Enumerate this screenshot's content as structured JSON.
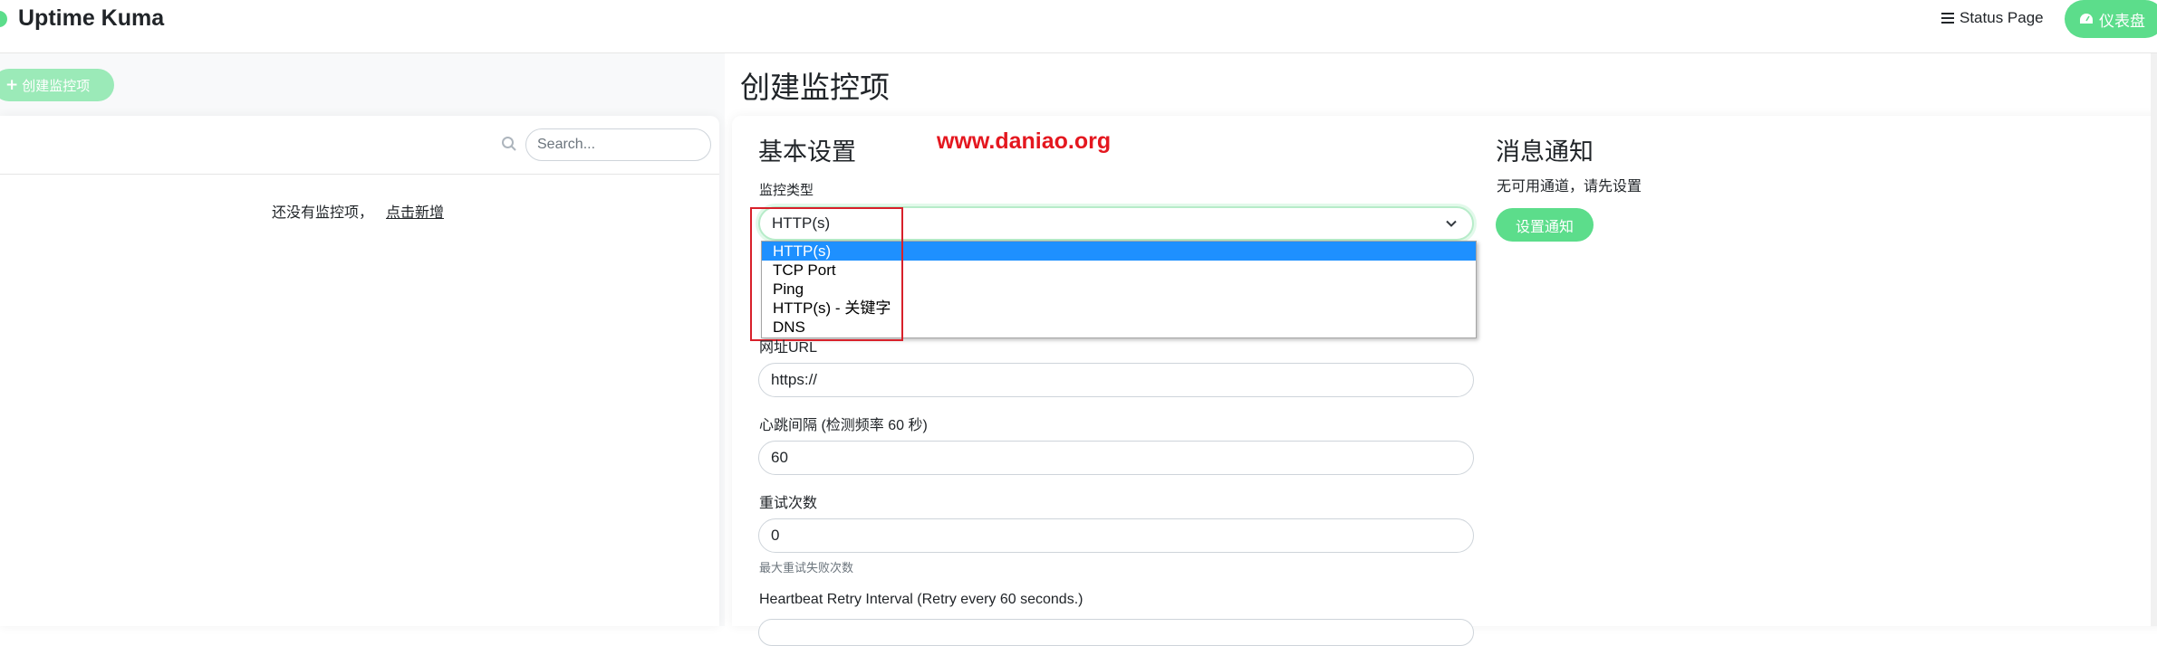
{
  "header": {
    "app_title": "Uptime Kuma",
    "status_page_label": "Status Page",
    "dashboard_label": "仪表盘"
  },
  "sidebar": {
    "create_button_label": "创建监控项",
    "search_placeholder": "Search...",
    "empty_text": "还没有监控项，",
    "empty_link": "点击新增"
  },
  "main": {
    "page_title": "创建监控项",
    "watermark": "www.daniao.org",
    "basic": {
      "section_title": "基本设置",
      "monitor_type_label": "监控类型",
      "monitor_type_value": "HTTP(s)",
      "monitor_type_options": [
        "HTTP(s)",
        "TCP Port",
        "Ping",
        "HTTP(s) - 关键字",
        "DNS"
      ],
      "url_label": "网址URL",
      "url_value": "https://",
      "interval_label": "心跳间隔 (检测频率 60 秒)",
      "interval_value": "60",
      "retries_label": "重试次数",
      "retries_value": "0",
      "retries_hint": "最大重试失败次数",
      "retry_interval_label": "Heartbeat Retry Interval (Retry every 60 seconds.)"
    },
    "notifications": {
      "section_title": "消息通知",
      "empty_text": "无可用通道，请先设置",
      "setup_button_label": "设置通知"
    }
  },
  "colors": {
    "accent": "#5cdd8b",
    "accent_light": "#9beab8",
    "selection": "#1e90ff",
    "highlight_box": "#d8202a",
    "watermark": "#e4171f"
  }
}
